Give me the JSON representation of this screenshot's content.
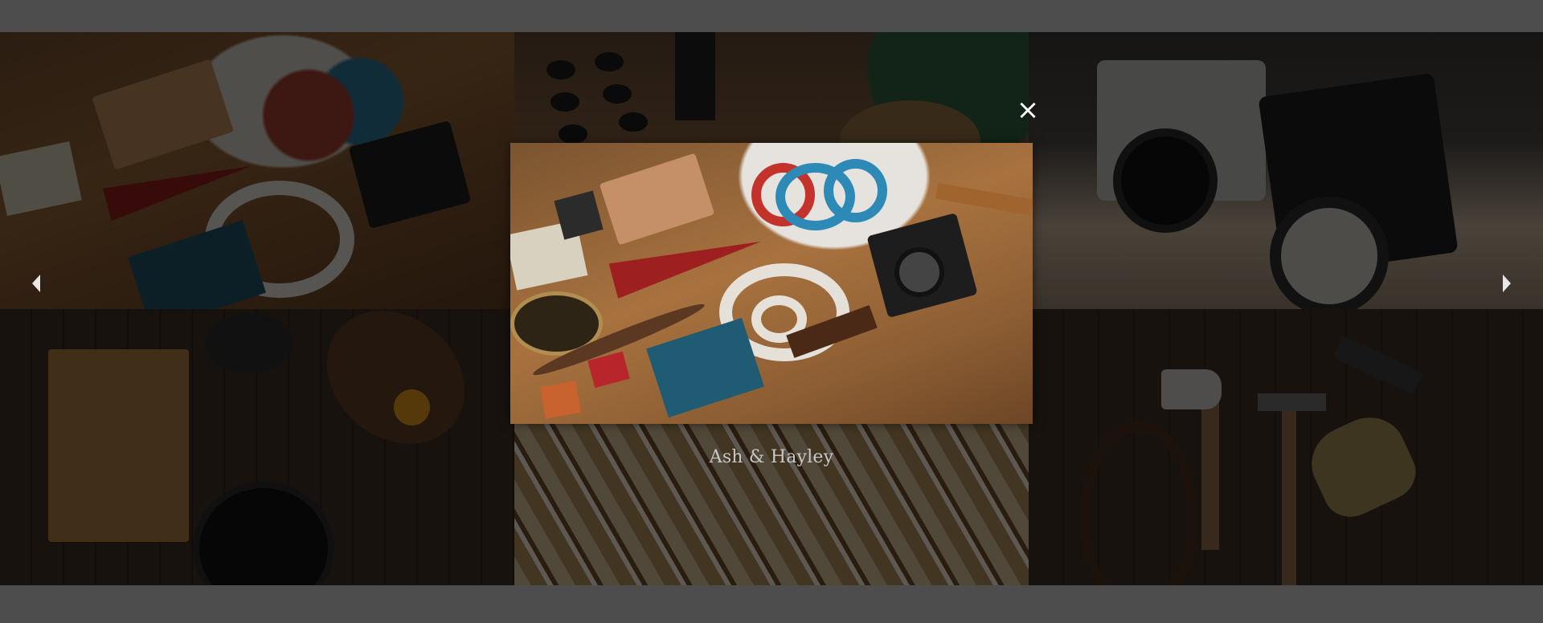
{
  "lightbox": {
    "caption": "Ash & Hayley",
    "close_label": "×",
    "prev_icon": "chevron-left-icon",
    "next_icon": "chevron-right-icon",
    "overlay_color": "#000000"
  },
  "gallery": {
    "tiles": [
      {
        "name": "workshop-desk-flatlay"
      },
      {
        "name": "wood-pegs-coaster"
      },
      {
        "name": "vintage-cameras"
      },
      {
        "name": "kitchen-board-herbs"
      },
      {
        "name": "wooden-rulers"
      },
      {
        "name": "hand-tools"
      }
    ]
  },
  "colors": {
    "page_background": "#4d4d4d",
    "caption_text": "#c8c8c8",
    "close_icon": "#ffffff"
  }
}
